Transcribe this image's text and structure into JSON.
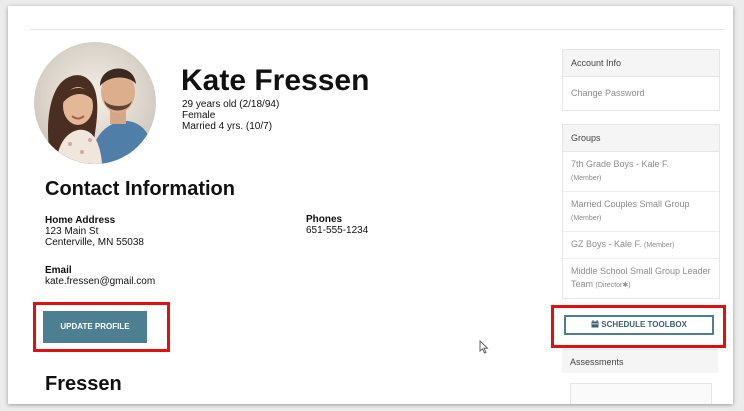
{
  "profile": {
    "name": "Kate Fressen",
    "age": "29 years old (2/18/94)",
    "gender": "Female",
    "married": "Married 4 yrs. (10/7)"
  },
  "contact": {
    "title": "Contact Information",
    "home_address_label": "Home Address",
    "address_line1": "123 Main St",
    "address_line2": "Centerville, MN 55038",
    "phones_label": "Phones",
    "phone": "651-555-1234",
    "email_label": "Email",
    "email": "kate.fressen@gmail.com"
  },
  "buttons": {
    "update_profile": "UPDATE PROFILE",
    "schedule_toolbox": "SCHEDULE TOOLBOX"
  },
  "section_lastname": "Fressen",
  "sidebar": {
    "account_header": "Account Info",
    "change_password": "Change Password",
    "groups_header": "Groups",
    "groups": [
      {
        "name": "7th Grade Boys - Kale F.",
        "role": "(Member)"
      },
      {
        "name": "Married Couples Small Group",
        "role": "(Member)"
      },
      {
        "name": "GZ Boys - Kale F.",
        "role": "(Member)"
      },
      {
        "name": "Middle School Small Group Leader Team",
        "role": "(Director✱)"
      }
    ],
    "assessments_header": "Assessments"
  },
  "colors": {
    "accent": "#4d7f93",
    "highlight": "#e01010"
  }
}
